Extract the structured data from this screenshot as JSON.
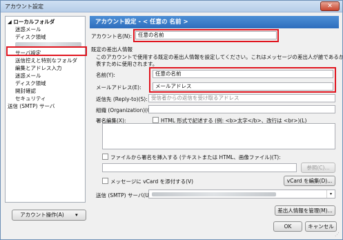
{
  "window": {
    "title": "アカウント設定",
    "close_glyph": "✕"
  },
  "tree": {
    "items": [
      {
        "label": "◢ ローカルフォルダ",
        "level": "l0"
      },
      {
        "label": "迷惑メール",
        "level": "l1"
      },
      {
        "label": "ディスク領域",
        "level": "l1"
      },
      {
        "label": "",
        "level": "blurred"
      },
      {
        "label": "サーバ設定",
        "level": "l1"
      },
      {
        "label": "送信控えと特別なフォルダ",
        "level": "l1"
      },
      {
        "label": "編集とアドレス入力",
        "level": "l1"
      },
      {
        "label": "迷惑メール",
        "level": "l1"
      },
      {
        "label": "ディスク領域",
        "level": "l1"
      },
      {
        "label": "開封確認",
        "level": "l1"
      },
      {
        "label": "セキュリティ",
        "level": "l1"
      },
      {
        "label": "送信 (SMTP) サーバ",
        "level": "plain"
      }
    ]
  },
  "account_ops": {
    "label": "アカウント操作(A)",
    "arrow": "▾"
  },
  "header": {
    "title": "アカウント設定 - < 任意の 名前 >"
  },
  "account_name": {
    "label": "アカウント名(N):",
    "value": "任意の名前"
  },
  "identity": {
    "section_label": "既定の差出人情報",
    "description_line1": "このアカウントで使用する既定の差出人情報を設定してください。これはメッセージの差出人が誰であるかを",
    "description_line2": "表すために使用されます。",
    "name_label": "名前(Y):",
    "name_value": "任意の名前",
    "email_label": "メールアドレス(E):",
    "email_value": "メールアドレス",
    "replyto_label": "返信先 (Reply-to)(S):",
    "replyto_placeholder": "受信者からの返信を受け取るアドレス",
    "org_label": "組織 (Organization)(O):",
    "org_value": "",
    "sig_label": "署名編集(X):",
    "html_checkbox_label": "HTML 形式で記述する (例: <b>太字</b>、改行は <br>)(L)"
  },
  "sig_file": {
    "checkbox_label": "ファイルから署名を挿入する (テキストまたは HTML、画像ファイル)(T):",
    "browse_label": "参照(C)..."
  },
  "vcard": {
    "checkbox_label": "メッセージに vCard を添付する(V)",
    "edit_label": "vCard を編集(D)..."
  },
  "smtp": {
    "label": "送信 (SMTP) サーバ(U):",
    "arrow": "▾"
  },
  "manage_identities_label": "差出人情報を管理(M)...",
  "ok_label": "OK",
  "cancel_label": "キャンセル"
}
